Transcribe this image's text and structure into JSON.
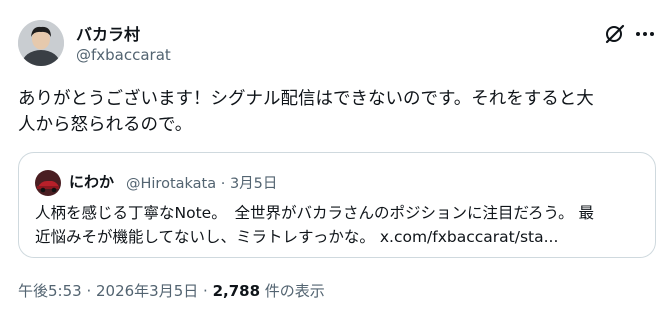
{
  "author": {
    "name": "バカラ村",
    "handle": "@fxbaccarat"
  },
  "icons": {
    "grok": "grok-icon",
    "more": "more-icon"
  },
  "tweet": {
    "line1": "ありがとうございます！シグナル配信はできないのです。それをすると大",
    "line2": "人から怒られるので。"
  },
  "quote": {
    "name": "にわか",
    "handle": "@Hirotakata · 3月5日",
    "line1": "人柄を感じる丁寧なNote。　全世界がバカラさんのポジションに注目だろう。 最",
    "line2": "近悩みそが機能してないし、ミラトレすっかな。 x.com/fxbaccarat/sta..."
  },
  "meta": {
    "time": "午後5:53 · 2026年3月5日",
    "separator": " · ",
    "views_count": "2,788",
    "views_label": "件の表示"
  },
  "colors": {
    "text": "#0f1419",
    "secondary": "#536471",
    "border": "#cfd9de"
  }
}
